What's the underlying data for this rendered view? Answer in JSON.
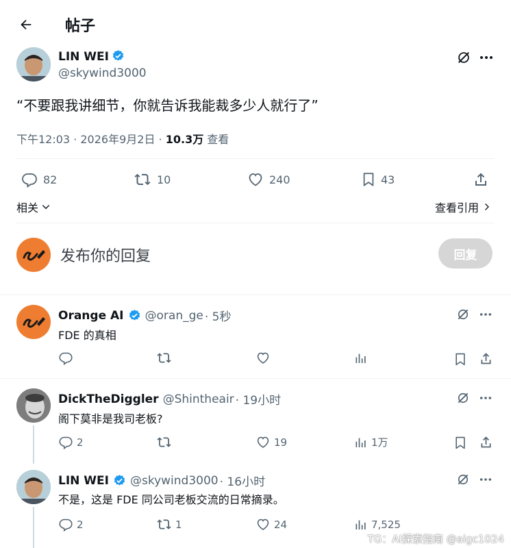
{
  "header": {
    "title": "帖子"
  },
  "post": {
    "author_name": "LIN WEI",
    "author_handle": "@skywind3000",
    "text": "“不要跟我讲细节，你就告诉我能裁多少人就行了”",
    "time": "下午12:03 · 2026年9月2日 · ",
    "views_count": "10.3万",
    "views_label": " 查看",
    "stats": {
      "replies": "82",
      "reposts": "10",
      "likes": "240",
      "bookmarks": "43"
    },
    "related_label": "相关",
    "view_quotes_label": "查看引用"
  },
  "compose": {
    "placeholder": "发布你的回复",
    "button_label": "回复"
  },
  "replies": [
    {
      "name": "Orange AI",
      "handle": "@oran_ge",
      "time": "· 5秒",
      "text": "FDE 的真相",
      "stats": {
        "replies": "",
        "reposts": "",
        "likes": "",
        "views": ""
      }
    },
    {
      "name": "DickTheDiggler",
      "handle": "@Shintheair",
      "time": "· 19小时",
      "text": "阁下莫非是我司老板?",
      "stats": {
        "replies": "2",
        "reposts": "",
        "likes": "19",
        "views": "1万"
      }
    },
    {
      "name": "LIN WEI",
      "handle": "@skywind3000",
      "time": "· 16小时",
      "text": "不是，这是 FDE 同公司老板交流的日常摘录。",
      "stats": {
        "replies": "2",
        "reposts": "1",
        "likes": "24",
        "views": "7,525"
      }
    }
  ],
  "watermark": "TG：AI探索指南 @aigc1024",
  "colors": {
    "accent": "#1d9bf0",
    "muted": "#536471",
    "orange_avatar": "#ef7d31",
    "button_disabled": "#d6d6d6"
  }
}
